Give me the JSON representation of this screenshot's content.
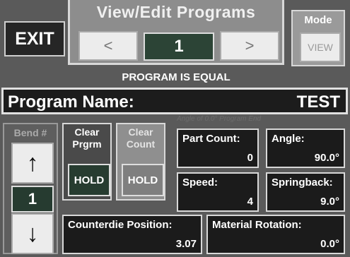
{
  "header": {
    "exit_label": "EXIT",
    "title": "View/Edit Programs",
    "prev_label": "<",
    "program_number": "1",
    "next_label": ">",
    "mode_label": "Mode",
    "mode_value": "VIEW"
  },
  "status_text": "PROGRAM IS EQUAL",
  "program": {
    "name_label": "Program Name:",
    "name_value": "TEST"
  },
  "faint_text": "Angle of 0.0° Program End",
  "bend": {
    "label": "Bend #",
    "up_icon": "↑",
    "value": "1",
    "down_icon": "↓"
  },
  "clear_program": {
    "label_line1": "Clear",
    "label_line2": "Prgrm",
    "hold_label": "HOLD"
  },
  "clear_count": {
    "label_line1": "Clear",
    "label_line2": "Count",
    "hold_label": "HOLD"
  },
  "fields": {
    "part_count": {
      "label": "Part Count:",
      "value": "0"
    },
    "angle": {
      "label": "Angle:",
      "value": "90.0°"
    },
    "speed": {
      "label": "Speed:",
      "value": "4"
    },
    "springback": {
      "label": "Springback:",
      "value": "9.0°"
    },
    "counterdie": {
      "label": "Counterdie Position:",
      "value": "3.07"
    },
    "material_rotation": {
      "label": "Material Rotation:",
      "value": "0.0°"
    }
  },
  "colors": {
    "panel_bg": "#5a5a5a",
    "value_box_bg": "#1b1b1b",
    "number_bg": "#2c4436",
    "button_bg": "#ececec"
  }
}
